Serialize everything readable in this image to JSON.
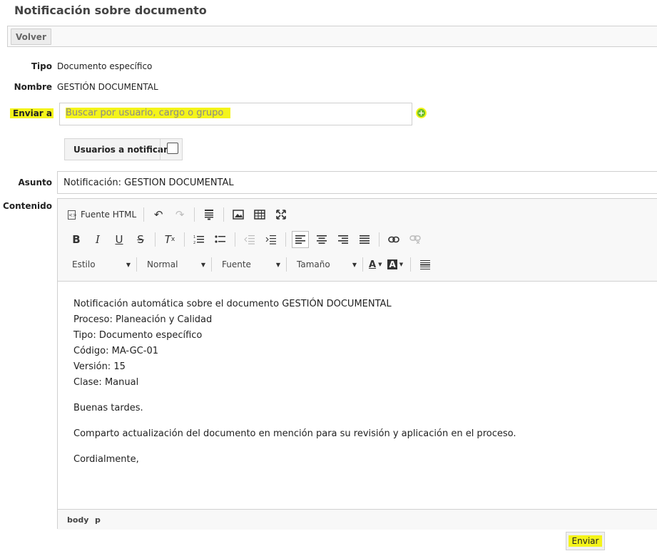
{
  "page": {
    "title": "Notificación sobre documento"
  },
  "toolbar": {
    "back_label": "Volver"
  },
  "form": {
    "type_label": "Tipo",
    "type_value": "Documento específico",
    "name_label": "Nombre",
    "name_value": "GESTIÓN DOCUMENTAL",
    "send_to_label": "Enviar a",
    "send_to_placeholder": "Buscar por usuario, cargo o grupo",
    "add_icon": "plus-circle-icon",
    "notify_users_label": "Usuarios a notificar",
    "notify_users_checked": false,
    "subject_label": "Asunto",
    "subject_value": "Notificación: GESTIÓN DOCUMENTAL",
    "content_label": "Contenido",
    "send_label": "Enviar"
  },
  "editor": {
    "source_label": "Fuente HTML",
    "combos": {
      "style": "Estilo",
      "format": "Normal",
      "font": "Fuente",
      "size": "Tamaño"
    },
    "body": {
      "line1": "Notificación automática sobre el documento GESTIÓN DOCUMENTAL",
      "line2": "Proceso: Planeación y Calidad",
      "line3": "Tipo: Documento específico",
      "line4": "Código: MA-GC-01",
      "line5": "Versión: 15",
      "line6": "Clase: Manual",
      "greeting": "Buenas tardes.",
      "message": "Comparto actualización del documento en mención para su revisión y aplicación en el proceso.",
      "closing": "Cordialmente,"
    },
    "path": [
      "body",
      "p"
    ]
  },
  "colors": {
    "highlight": "#f4f41a",
    "add_icon": "#6cbf2a"
  }
}
